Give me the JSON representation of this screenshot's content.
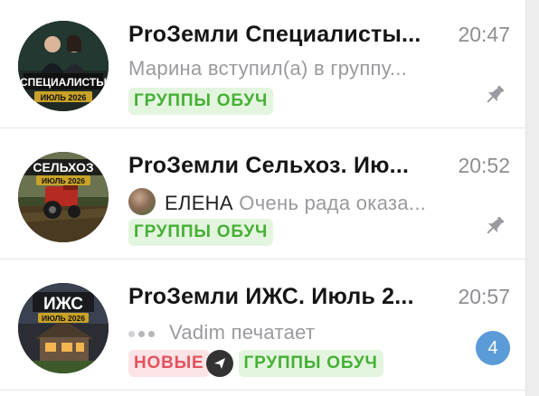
{
  "chats": [
    {
      "title": "ProЗемли Специалисты...",
      "time": "20:47",
      "preview": "Марина вступил(а) в группу...",
      "folders": [
        "ГРУППЫ ОБУЧ"
      ],
      "pinned": true,
      "avatar": {
        "line1": "СПЕЦИАЛИСТЫ",
        "line2": "ИЮЛЬ 2026",
        "colors": {
          "bg": "#1f2a24",
          "plate": "#c9a227"
        }
      }
    },
    {
      "title": "ProЗемли Сельхоз. Ию...",
      "time": "20:52",
      "sender": "ЕЛЕНА",
      "preview": "Очень рада оказа...",
      "folders": [
        "ГРУППЫ ОБУЧ"
      ],
      "pinned": true,
      "avatar": {
        "line1": "СЕЛЬХОЗ",
        "line2": "ИЮЛЬ 2026",
        "colors": {
          "bg": "#3d4a2a",
          "plate": "#c9a227"
        }
      }
    },
    {
      "title": "ProЗемли ИЖС. Июль 2...",
      "time": "20:57",
      "sender": "Vadim",
      "preview": "печатает",
      "folders": [
        "НОВЫЕ",
        "ГРУППЫ ОБУЧ"
      ],
      "unread_count": "4",
      "avatar": {
        "line1": "ИЖС",
        "line2": "ИЮЛЬ 2026",
        "colors": {
          "bg": "#2a2d33",
          "plate": "#c9a227"
        }
      }
    }
  ],
  "colors": {
    "folder_green": "#45b035",
    "folder_red": "#e5525c",
    "badge_blue": "#5a9bd8"
  },
  "icons": [
    "pin-icon",
    "typing-indicator-icon",
    "send-arrow-icon"
  ]
}
